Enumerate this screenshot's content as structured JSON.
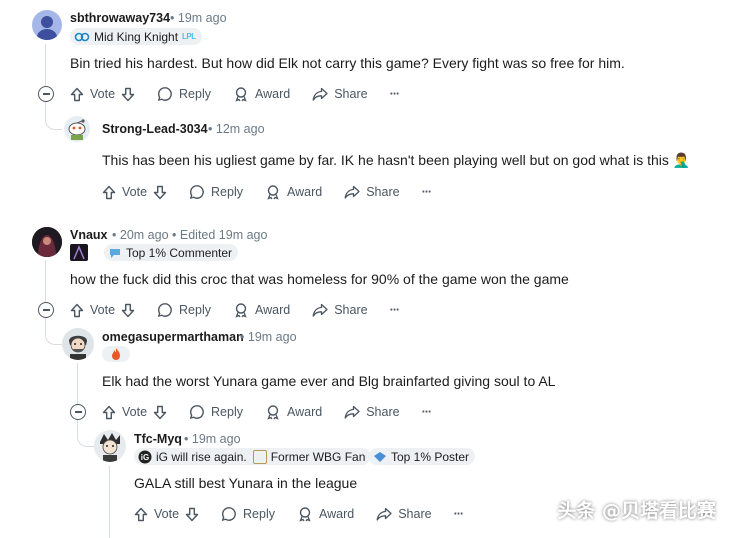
{
  "comments": [
    {
      "author": "sbthrowaway734",
      "time": "19m ago",
      "flairs": [
        "Mid King Knight"
      ],
      "flair_emblem": "LPL",
      "body": "Bin tried his hardest. But how did Elk not carry this game? Every fight was so free for him."
    },
    {
      "author": "Strong-Lead-3034",
      "time": "12m ago",
      "flairs": [],
      "body": "This has been his ugliest game by far. IK he hasn't been playing well but on god what is this 🤦‍♂️"
    },
    {
      "author": "Vnaux",
      "time": "20m ago",
      "edited": "Edited 19m ago",
      "flairs": [
        "Top 1% Commenter"
      ],
      "body": "how the fuck did this croc that was homeless for 90% of the game won the game"
    },
    {
      "author": "omegasupermarthaman",
      "time": "19m ago",
      "flairs": [],
      "body": "Elk had the worst Yunara game ever and Blg brainfarted giving soul to AL"
    },
    {
      "author": "Tfc-Myq",
      "time": "19m ago",
      "flairs": [
        "iG will rise again.",
        "Former WBG Fan",
        "Top 1% Poster"
      ],
      "body": "GALA still best Yunara in the league"
    }
  ],
  "actions": {
    "vote": "Vote",
    "reply": "Reply",
    "award": "Award",
    "share": "Share",
    "more": "···"
  },
  "separator": "•",
  "watermark": "头条 @贝塔看比赛",
  "icons": {
    "upvote": "arrow-up-icon",
    "downvote": "arrow-down-icon",
    "reply": "speech-bubble-icon",
    "award": "medal-icon",
    "share": "share-arrow-icon",
    "collapse": "minus-circle-icon"
  },
  "colors": {
    "text": "#1c1c1c",
    "meta": "#6b7a86",
    "thread": "#d8dde2",
    "flair_bg": "#eef1f3",
    "accent": "#4fbdf2"
  }
}
